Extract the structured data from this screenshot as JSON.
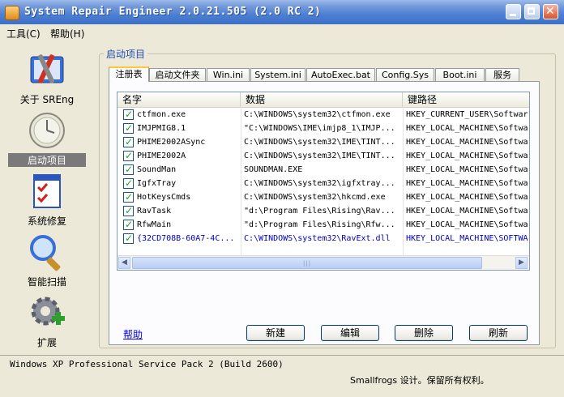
{
  "window": {
    "title": "System Repair Engineer 2.0.21.505 (2.0 RC 2)"
  },
  "menu": [
    "工具(C)",
    "帮助(H)"
  ],
  "sidebar": {
    "items": [
      {
        "label": "关于 SREng",
        "icon": "toolbox-icon"
      },
      {
        "label": "启动项目",
        "icon": "clock-icon",
        "selected": true
      },
      {
        "label": "系统修复",
        "icon": "checklist-icon"
      },
      {
        "label": "智能扫描",
        "icon": "magnifier-icon"
      },
      {
        "label": "扩展",
        "icon": "gear-plus-icon"
      }
    ]
  },
  "group_title": "启动项目",
  "tabs": [
    "注册表",
    "启动文件夹",
    "Win.ini",
    "System.ini",
    "AutoExec.bat",
    "Config.Sys",
    "Boot.ini",
    "服务"
  ],
  "active_tab": "注册表",
  "list": {
    "columns": [
      "名字",
      "数据",
      "键路径"
    ],
    "rows": [
      {
        "name": "ctfmon.exe",
        "data": "C:\\WINDOWS\\system32\\ctfmon.exe",
        "key": "HKEY_CURRENT_USER\\Softwar"
      },
      {
        "name": "IMJPMIG8.1",
        "data": "\"C:\\WINDOWS\\IME\\imjp8_1\\IMJP...",
        "key": "HKEY_LOCAL_MACHINE\\Softwa"
      },
      {
        "name": "PHIME2002ASync",
        "data": "C:\\WINDOWS\\system32\\IME\\TINT...",
        "key": "HKEY_LOCAL_MACHINE\\Softwa"
      },
      {
        "name": "PHIME2002A",
        "data": "C:\\WINDOWS\\system32\\IME\\TINT...",
        "key": "HKEY_LOCAL_MACHINE\\Softwa"
      },
      {
        "name": "SoundMan",
        "data": "SOUNDMAN.EXE",
        "key": "HKEY_LOCAL_MACHINE\\Softwa"
      },
      {
        "name": "IgfxTray",
        "data": "C:\\WINDOWS\\system32\\igfxtray...",
        "key": "HKEY_LOCAL_MACHINE\\Softwa"
      },
      {
        "name": "HotKeysCmds",
        "data": "C:\\WINDOWS\\system32\\hkcmd.exe",
        "key": "HKEY_LOCAL_MACHINE\\Softwa"
      },
      {
        "name": "RavTask",
        "data": "\"d:\\Program Files\\Rising\\Rav...",
        "key": "HKEY_LOCAL_MACHINE\\Softwa"
      },
      {
        "name": "RfwMain",
        "data": "\"d:\\Program Files\\Rising\\Rfw...",
        "key": "HKEY_LOCAL_MACHINE\\Softwa"
      },
      {
        "name": "{32CD708B-60A7-4C...",
        "data": "C:\\WINDOWS\\system32\\RavExt.dll",
        "key": "HKEY_LOCAL_MACHINE\\SOFTWA"
      }
    ]
  },
  "help_link": "帮助",
  "buttons": {
    "new": "新建",
    "edit": "编辑",
    "delete": "删除",
    "refresh": "刷新"
  },
  "status": {
    "os": "Windows XP Professional Service Pack 2 (Build 2600)",
    "copyright": "Smallfrogs 设计。保留所有权利。"
  },
  "colors": {
    "titlebar": "#3d6fc7",
    "link": "#0000ff",
    "row_highlight": "#0000c0",
    "check": "#21a121"
  }
}
